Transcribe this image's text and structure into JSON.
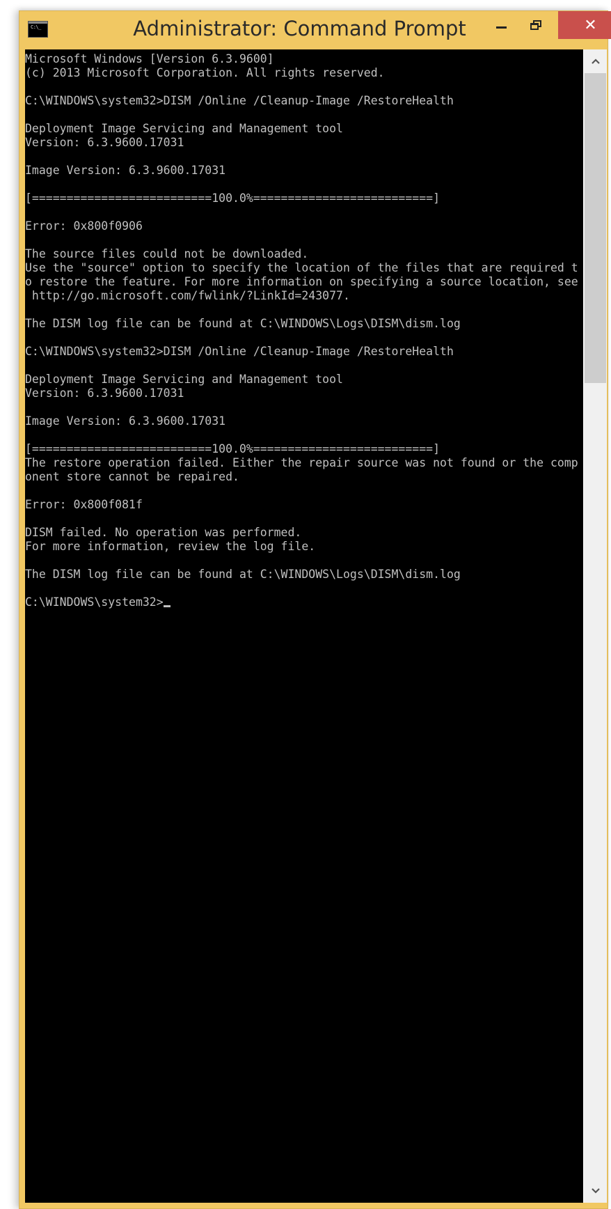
{
  "window": {
    "title": "Administrator: Command Prompt",
    "icon_label": "C:\\_",
    "controls": {
      "minimize": "minimize",
      "maximize": "restore",
      "close": "✕"
    },
    "colors": {
      "frame": "#f1c863",
      "close_button": "#c9504c",
      "console_bg": "#000000",
      "console_text": "#c0c0c0"
    }
  },
  "console": {
    "lines": [
      "Microsoft Windows [Version 6.3.9600]",
      "(c) 2013 Microsoft Corporation. All rights reserved.",
      "",
      "C:\\WINDOWS\\system32>DISM /Online /Cleanup-Image /RestoreHealth",
      "",
      "Deployment Image Servicing and Management tool",
      "Version: 6.3.9600.17031",
      "",
      "Image Version: 6.3.9600.17031",
      "",
      "[==========================100.0%==========================]",
      "",
      "Error: 0x800f0906",
      "",
      "The source files could not be downloaded.",
      "Use the \"source\" option to specify the location of the files that are required t",
      "o restore the feature. For more information on specifying a source location, see",
      " http://go.microsoft.com/fwlink/?LinkId=243077.",
      "",
      "The DISM log file can be found at C:\\WINDOWS\\Logs\\DISM\\dism.log",
      "",
      "C:\\WINDOWS\\system32>DISM /Online /Cleanup-Image /RestoreHealth",
      "",
      "Deployment Image Servicing and Management tool",
      "Version: 6.3.9600.17031",
      "",
      "Image Version: 6.3.9600.17031",
      "",
      "[==========================100.0%==========================]",
      "The restore operation failed. Either the repair source was not found or the comp",
      "onent store cannot be repaired.",
      "",
      "Error: 0x800f081f",
      "",
      "DISM failed. No operation was performed.",
      "For more information, review the log file.",
      "",
      "The DISM log file can be found at C:\\WINDOWS\\Logs\\DISM\\dism.log",
      ""
    ],
    "prompt": "C:\\WINDOWS\\system32>",
    "input_value": ""
  },
  "scrollbar": {
    "up_arrow": "⌃",
    "down_arrow": "⌄",
    "thumb_position_fraction": 0.0,
    "visible_fraction": 0.28
  }
}
